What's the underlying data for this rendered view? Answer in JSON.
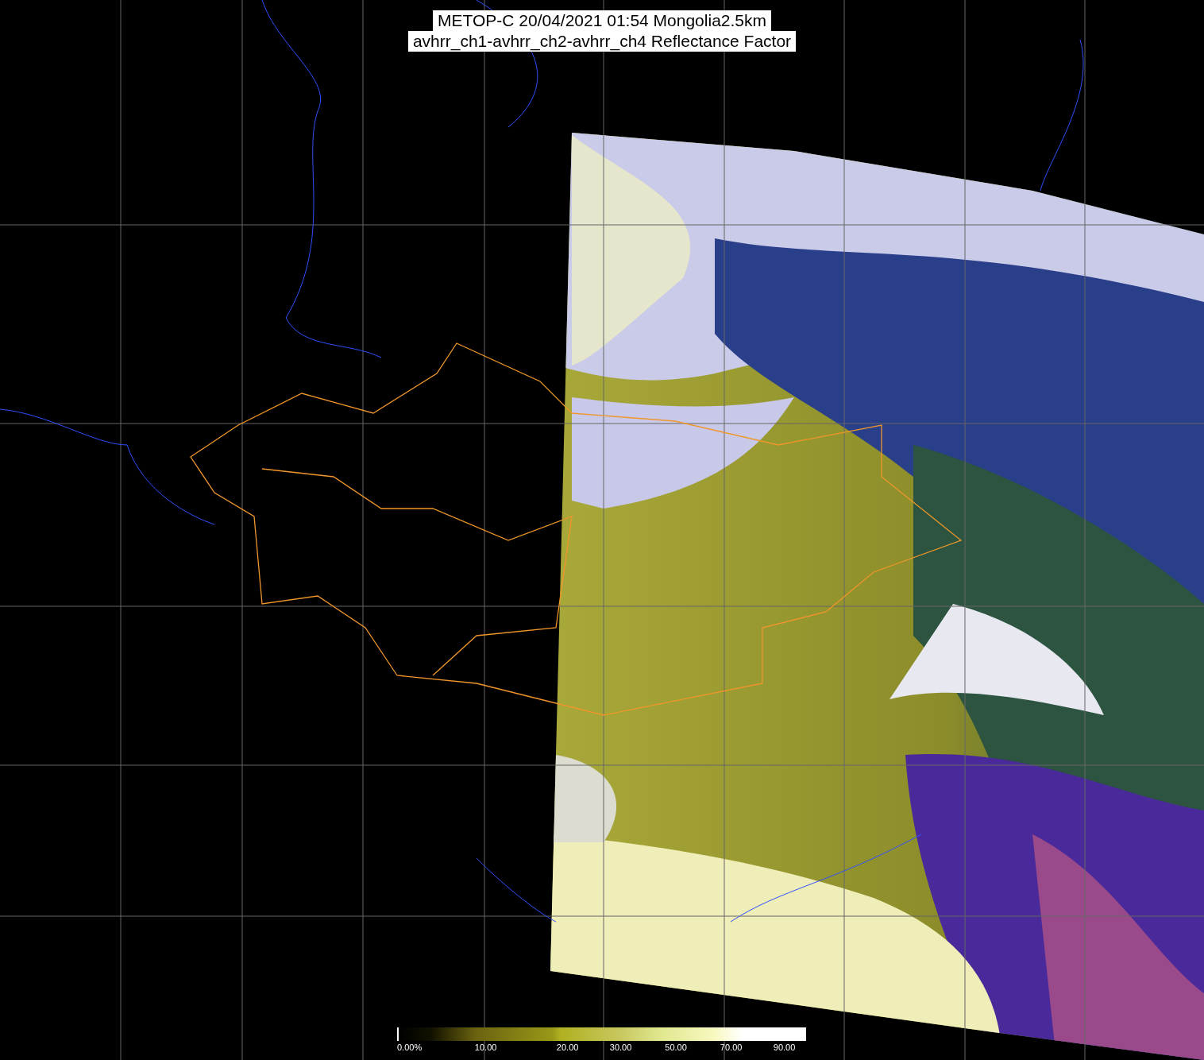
{
  "title": {
    "lines": [
      "METOP-C 20/04/2021 01:54 Mongolia2.5km",
      "avhrr_ch1-avhrr_ch2-avhrr_ch4 Reflectance Factor"
    ]
  },
  "colorbar": {
    "labels": [
      "0.00%",
      "10.00",
      "20.00",
      "30.00",
      "50.00",
      "70.00",
      "90.00"
    ]
  }
}
